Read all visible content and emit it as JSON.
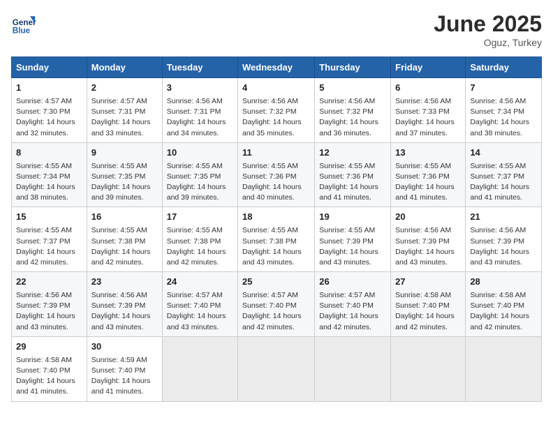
{
  "header": {
    "logo_general": "General",
    "logo_blue": "Blue",
    "month_year": "June 2025",
    "location": "Oguz, Turkey"
  },
  "days_of_week": [
    "Sunday",
    "Monday",
    "Tuesday",
    "Wednesday",
    "Thursday",
    "Friday",
    "Saturday"
  ],
  "weeks": [
    [
      {
        "day": 1,
        "sunrise": "4:57 AM",
        "sunset": "7:30 PM",
        "daylight": "14 hours and 32 minutes."
      },
      {
        "day": 2,
        "sunrise": "4:57 AM",
        "sunset": "7:31 PM",
        "daylight": "14 hours and 33 minutes."
      },
      {
        "day": 3,
        "sunrise": "4:56 AM",
        "sunset": "7:31 PM",
        "daylight": "14 hours and 34 minutes."
      },
      {
        "day": 4,
        "sunrise": "4:56 AM",
        "sunset": "7:32 PM",
        "daylight": "14 hours and 35 minutes."
      },
      {
        "day": 5,
        "sunrise": "4:56 AM",
        "sunset": "7:32 PM",
        "daylight": "14 hours and 36 minutes."
      },
      {
        "day": 6,
        "sunrise": "4:56 AM",
        "sunset": "7:33 PM",
        "daylight": "14 hours and 37 minutes."
      },
      {
        "day": 7,
        "sunrise": "4:56 AM",
        "sunset": "7:34 PM",
        "daylight": "14 hours and 38 minutes."
      }
    ],
    [
      {
        "day": 8,
        "sunrise": "4:55 AM",
        "sunset": "7:34 PM",
        "daylight": "14 hours and 38 minutes."
      },
      {
        "day": 9,
        "sunrise": "4:55 AM",
        "sunset": "7:35 PM",
        "daylight": "14 hours and 39 minutes."
      },
      {
        "day": 10,
        "sunrise": "4:55 AM",
        "sunset": "7:35 PM",
        "daylight": "14 hours and 39 minutes."
      },
      {
        "day": 11,
        "sunrise": "4:55 AM",
        "sunset": "7:36 PM",
        "daylight": "14 hours and 40 minutes."
      },
      {
        "day": 12,
        "sunrise": "4:55 AM",
        "sunset": "7:36 PM",
        "daylight": "14 hours and 41 minutes."
      },
      {
        "day": 13,
        "sunrise": "4:55 AM",
        "sunset": "7:36 PM",
        "daylight": "14 hours and 41 minutes."
      },
      {
        "day": 14,
        "sunrise": "4:55 AM",
        "sunset": "7:37 PM",
        "daylight": "14 hours and 41 minutes."
      }
    ],
    [
      {
        "day": 15,
        "sunrise": "4:55 AM",
        "sunset": "7:37 PM",
        "daylight": "14 hours and 42 minutes."
      },
      {
        "day": 16,
        "sunrise": "4:55 AM",
        "sunset": "7:38 PM",
        "daylight": "14 hours and 42 minutes."
      },
      {
        "day": 17,
        "sunrise": "4:55 AM",
        "sunset": "7:38 PM",
        "daylight": "14 hours and 42 minutes."
      },
      {
        "day": 18,
        "sunrise": "4:55 AM",
        "sunset": "7:38 PM",
        "daylight": "14 hours and 43 minutes."
      },
      {
        "day": 19,
        "sunrise": "4:55 AM",
        "sunset": "7:39 PM",
        "daylight": "14 hours and 43 minutes."
      },
      {
        "day": 20,
        "sunrise": "4:56 AM",
        "sunset": "7:39 PM",
        "daylight": "14 hours and 43 minutes."
      },
      {
        "day": 21,
        "sunrise": "4:56 AM",
        "sunset": "7:39 PM",
        "daylight": "14 hours and 43 minutes."
      }
    ],
    [
      {
        "day": 22,
        "sunrise": "4:56 AM",
        "sunset": "7:39 PM",
        "daylight": "14 hours and 43 minutes."
      },
      {
        "day": 23,
        "sunrise": "4:56 AM",
        "sunset": "7:39 PM",
        "daylight": "14 hours and 43 minutes."
      },
      {
        "day": 24,
        "sunrise": "4:57 AM",
        "sunset": "7:40 PM",
        "daylight": "14 hours and 43 minutes."
      },
      {
        "day": 25,
        "sunrise": "4:57 AM",
        "sunset": "7:40 PM",
        "daylight": "14 hours and 42 minutes."
      },
      {
        "day": 26,
        "sunrise": "4:57 AM",
        "sunset": "7:40 PM",
        "daylight": "14 hours and 42 minutes."
      },
      {
        "day": 27,
        "sunrise": "4:58 AM",
        "sunset": "7:40 PM",
        "daylight": "14 hours and 42 minutes."
      },
      {
        "day": 28,
        "sunrise": "4:58 AM",
        "sunset": "7:40 PM",
        "daylight": "14 hours and 42 minutes."
      }
    ],
    [
      {
        "day": 29,
        "sunrise": "4:58 AM",
        "sunset": "7:40 PM",
        "daylight": "14 hours and 41 minutes."
      },
      {
        "day": 30,
        "sunrise": "4:59 AM",
        "sunset": "7:40 PM",
        "daylight": "14 hours and 41 minutes."
      },
      null,
      null,
      null,
      null,
      null
    ]
  ]
}
